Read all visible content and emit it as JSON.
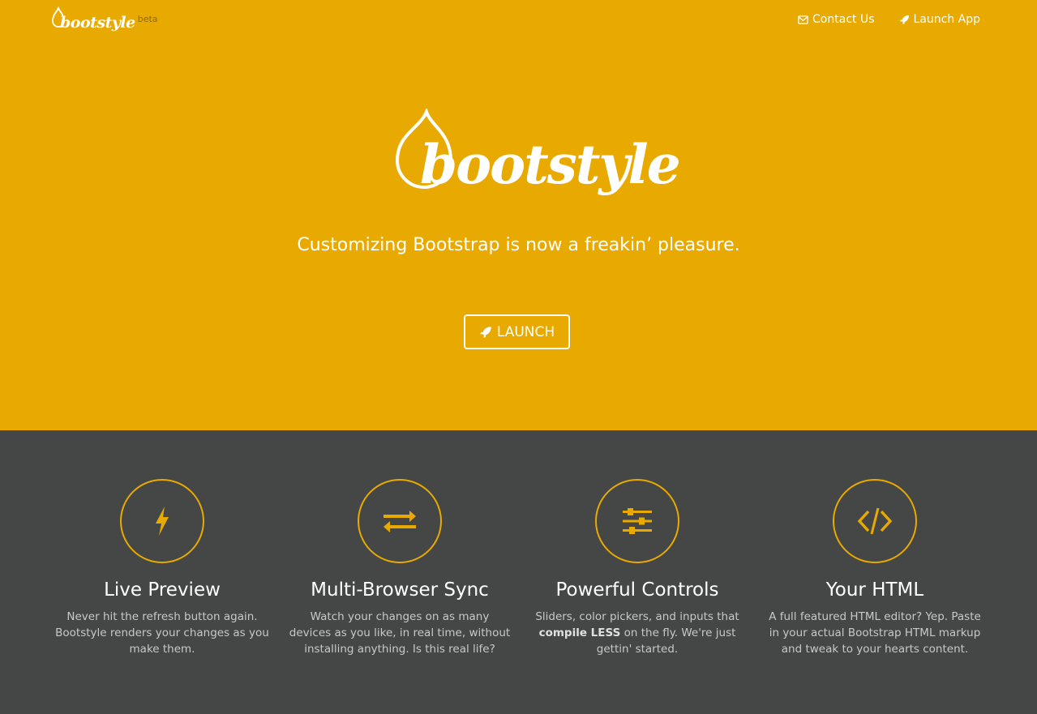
{
  "brand": {
    "name": "bootstyle",
    "badge": "beta"
  },
  "nav": [
    {
      "label": "Contact Us",
      "icon": "envelope-icon"
    },
    {
      "label": "Launch App",
      "icon": "rocket-icon"
    }
  ],
  "hero": {
    "logo_text": "bootstyle",
    "tagline": "Customizing Bootstrap is now a freakin’ pleasure.",
    "button_label": "LAUNCH",
    "button_icon": "rocket-icon"
  },
  "features": [
    {
      "icon": "lightning-icon",
      "title": "Live Preview",
      "desc_html": "Never hit the refresh button again. Bootstyle renders your changes as you make them."
    },
    {
      "icon": "sync-arrows-icon",
      "title": "Multi-Browser Sync",
      "desc_html": "Watch your changes on as many devices as you like, in real time, without installing anything. Is this real life?"
    },
    {
      "icon": "sliders-icon",
      "title": "Powerful Controls",
      "desc_html": "Sliders, color pickers, and inputs that <b>compile LESS</b> on the fly. We're just gettin' started."
    },
    {
      "icon": "code-icon",
      "title": "Your HTML",
      "desc_html": "A full featured HTML editor? Yep. Paste in your actual Bootstrap HTML markup and tweak to your hearts content."
    }
  ],
  "colors": {
    "accent": "#e8a900",
    "dark": "#444746",
    "text_light": "#c8c8c8"
  }
}
